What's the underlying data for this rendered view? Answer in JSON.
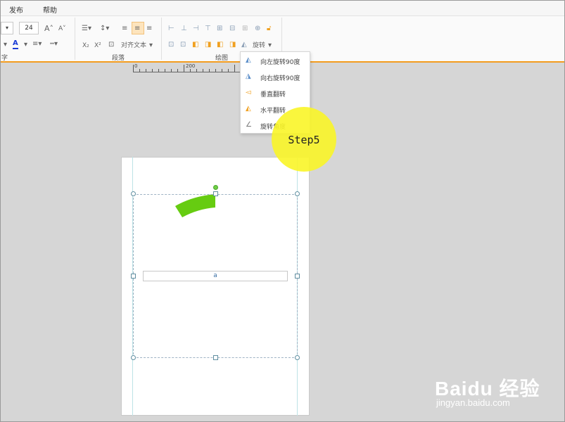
{
  "menubar": {
    "items": [
      "发布",
      "帮助"
    ]
  },
  "ribbon": {
    "font_size": "24",
    "groups": {
      "font": "字",
      "paragraph": "段落",
      "drawing": "绘图"
    },
    "align_text_label": "对齐文本",
    "rotate_label": "旋转"
  },
  "ruler": {
    "labels": [
      "0",
      "200"
    ]
  },
  "rotate_menu": {
    "items": [
      {
        "label": "向左旋转90度",
        "icon": "rotate-left-icon"
      },
      {
        "label": "向右旋转90度",
        "icon": "rotate-right-icon"
      },
      {
        "label": "垂直翻转",
        "icon": "flip-vertical-icon"
      },
      {
        "label": "水平翻转",
        "icon": "flip-horizontal-icon"
      },
      {
        "label": "旋转角度",
        "icon": "rotation-angle-icon"
      }
    ]
  },
  "canvas": {
    "textbox_text": "a",
    "shape_color": "#66cc11"
  },
  "step_badge": {
    "text": "Step5",
    "color": "#f8f22a"
  },
  "watermark": {
    "logo": "Baidu 经验",
    "url": "jingyan.baidu.com"
  },
  "colors": {
    "accent": "#f39c1f"
  }
}
